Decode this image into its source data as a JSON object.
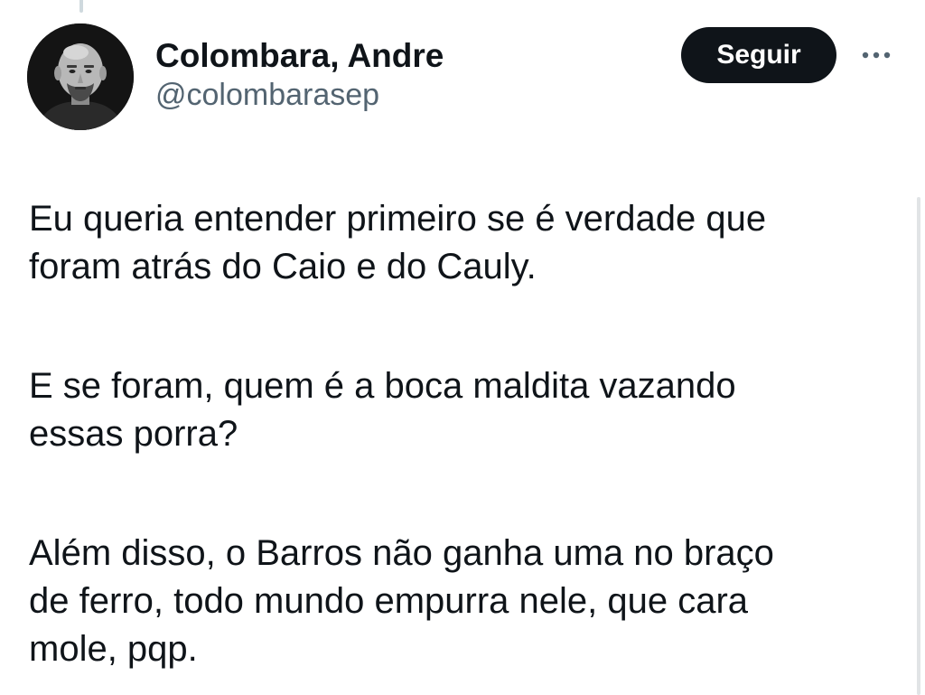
{
  "author": {
    "display_name": "Colombara, Andre",
    "handle": "@colombarasep"
  },
  "actions": {
    "follow_label": "Seguir",
    "more_icon": "more-horizontal-icon"
  },
  "tweet": {
    "paragraphs": [
      {
        "lines": [
          "Eu queria entender primeiro se é verdade que",
          "foram atrás do Caio e do Cauly."
        ]
      },
      {
        "lines": [
          "E se foram, quem é a boca maldita vazando",
          "essas porra?"
        ]
      },
      {
        "lines": [
          "Além disso, o Barros não ganha uma no braço",
          "de ferro, todo mundo empurra nele, que cara",
          "mole, pqp."
        ]
      }
    ]
  },
  "colors": {
    "text": "#0f1419",
    "secondary_text": "#536471",
    "follow_button_bg": "#0f1419",
    "follow_button_text": "#ffffff",
    "thread_line": "#cfd9de"
  }
}
